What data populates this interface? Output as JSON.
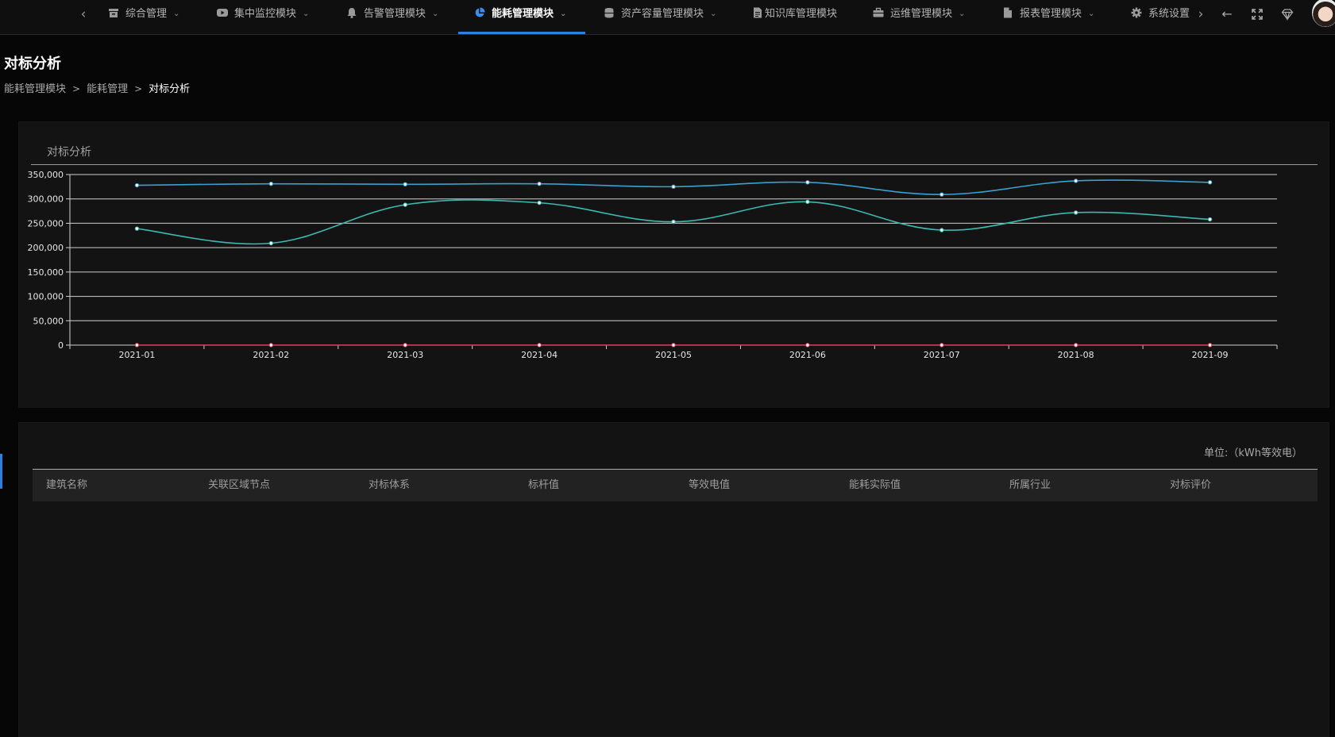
{
  "nav": {
    "items": [
      {
        "label": "综合管理",
        "icon": "archive-icon"
      },
      {
        "label": "集中监控模块",
        "icon": "video-icon"
      },
      {
        "label": "告警管理模块",
        "icon": "bell-icon"
      },
      {
        "label": "能耗管理模块",
        "icon": "pie-chart-icon",
        "active": true
      },
      {
        "label": "资产容量管理模块",
        "icon": "database-icon"
      },
      {
        "label": "知识库管理模块",
        "icon": "document-icon"
      },
      {
        "label": "运维管理模块",
        "icon": "briefcase-icon"
      },
      {
        "label": "报表管理模块",
        "icon": "file-icon"
      },
      {
        "label": "系统设置",
        "icon": "gear-icon"
      }
    ],
    "accent": "#2f7fe0"
  },
  "page": {
    "title": "对标分析",
    "breadcrumb": [
      "能耗管理模块",
      "能耗管理",
      "对标分析"
    ]
  },
  "chart_panel": {
    "title": "对标分析"
  },
  "chart_data": {
    "type": "line",
    "categories": [
      "2021-01",
      "2021-02",
      "2021-03",
      "2021-04",
      "2021-05",
      "2021-06",
      "2021-07",
      "2021-08",
      "2021-09"
    ],
    "series": [
      {
        "color": "#3aa0d0",
        "values": [
          328000,
          331000,
          330000,
          331000,
          325000,
          334000,
          309000,
          337000,
          334000
        ]
      },
      {
        "color": "#3bb8b0",
        "values": [
          239000,
          209000,
          288000,
          292000,
          253000,
          294000,
          236000,
          272000,
          258000
        ]
      },
      {
        "color": "#e0415e",
        "values": [
          0,
          0,
          0,
          0,
          0,
          0,
          0,
          0,
          0
        ]
      }
    ],
    "ylim": [
      0,
      350000
    ],
    "yticks": [
      "0",
      "50,000",
      "100,000",
      "150,000",
      "200,000",
      "250,000",
      "300,000",
      "350,000"
    ],
    "grid": true
  },
  "table": {
    "unit": "单位:（kWh等效电）",
    "columns": [
      "建筑名称",
      "关联区域节点",
      "对标体系",
      "标杆值",
      "等效电值",
      "能耗实际值",
      "所属行业",
      "对标评价"
    ],
    "rows": []
  }
}
